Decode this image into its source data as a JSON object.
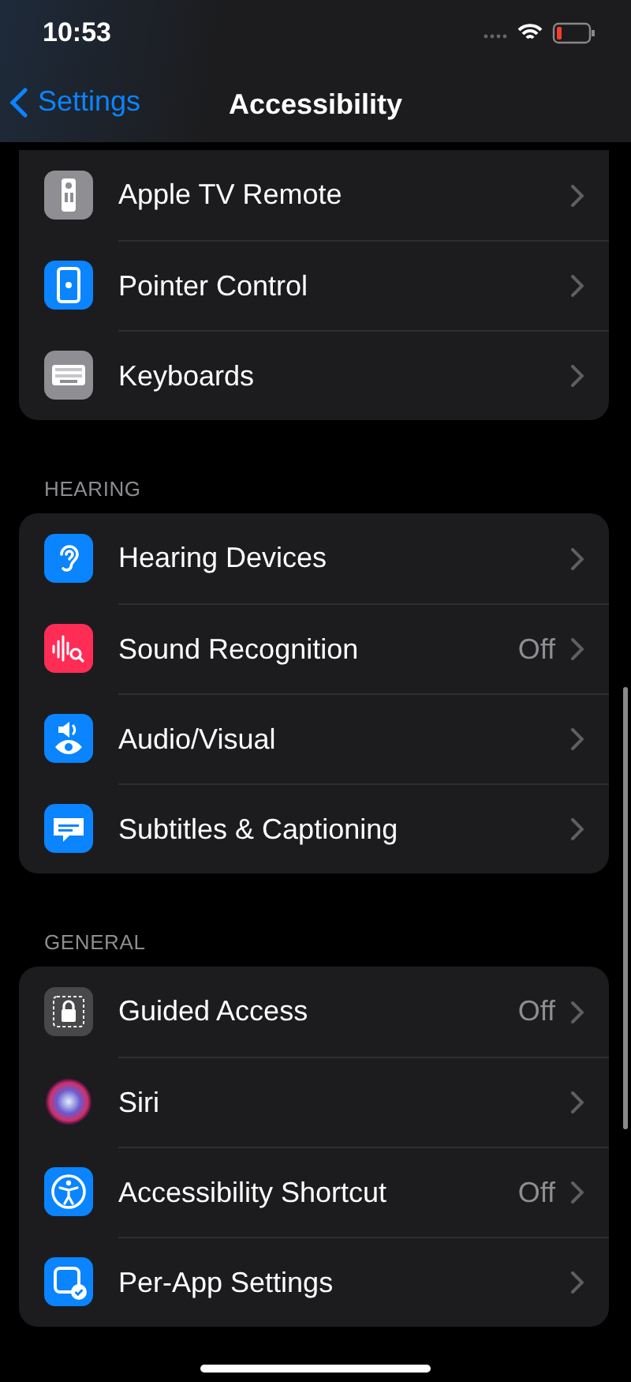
{
  "status_bar": {
    "time": "10:53"
  },
  "nav": {
    "back": "Settings",
    "title": "Accessibility"
  },
  "sections": [
    {
      "items": [
        {
          "label": "Apple TV Remote"
        },
        {
          "label": "Pointer Control"
        },
        {
          "label": "Keyboards"
        }
      ]
    },
    {
      "header": "HEARING",
      "items": [
        {
          "label": "Hearing Devices"
        },
        {
          "label": "Sound Recognition",
          "value": "Off"
        },
        {
          "label": "Audio/Visual"
        },
        {
          "label": "Subtitles & Captioning"
        }
      ]
    },
    {
      "header": "GENERAL",
      "items": [
        {
          "label": "Guided Access",
          "value": "Off"
        },
        {
          "label": "Siri"
        },
        {
          "label": "Accessibility Shortcut",
          "value": "Off"
        },
        {
          "label": "Per-App Settings"
        }
      ]
    }
  ]
}
